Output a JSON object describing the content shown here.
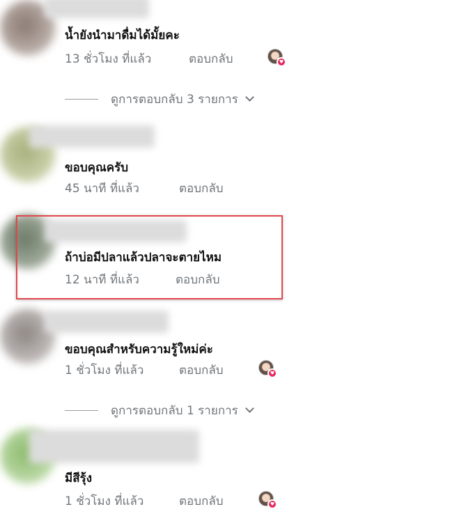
{
  "comments": [
    {
      "text": "น้ำยังนำมาดื่มได้มั้ยคะ",
      "time": "13 ชั่วโมง ที่แล้ว",
      "reply": "ตอบกลับ",
      "view_replies": "ดูการตอบกลับ 3 รายการ",
      "liked_by_author": true
    },
    {
      "text": "ขอบคุณครับ",
      "time": "45 นาที ที่แล้ว",
      "reply": "ตอบกลับ",
      "liked_by_author": false
    },
    {
      "text": "ถ้าบ่อมีปลาแล้วปลาจะตายไหม",
      "time": "12 นาที ที่แล้ว",
      "reply": "ตอบกลับ",
      "liked_by_author": false
    },
    {
      "text": "ขอบคุณสำหรับความรู้ใหม่ค่ะ",
      "time": "1 ชั่วโมง ที่แล้ว",
      "reply": "ตอบกลับ",
      "view_replies": "ดูการตอบกลับ 1 รายการ",
      "liked_by_author": true
    },
    {
      "text": "มีสีรุ้ง",
      "time": "1 ชั่วโมง ที่แล้ว",
      "reply": "ตอบกลับ",
      "liked_by_author": true
    }
  ],
  "icons": {
    "like_badge": "heart-icon",
    "expand": "chevron-down-icon"
  },
  "colors": {
    "highlight_border": "#e0474c",
    "heart": "#e8265e"
  }
}
